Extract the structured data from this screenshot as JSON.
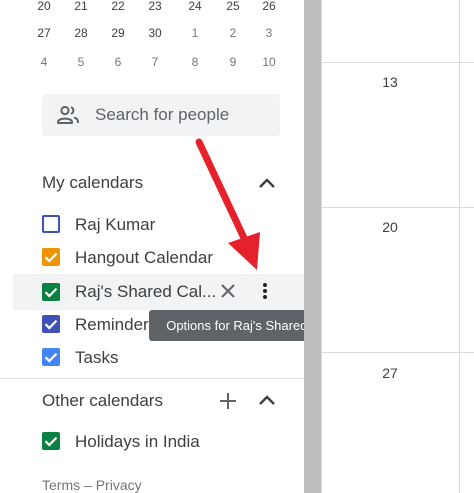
{
  "mini_calendar": {
    "rows": [
      [
        "20",
        "21",
        "22",
        "23",
        "24",
        "25",
        "26"
      ],
      [
        "27",
        "28",
        "29",
        "30",
        "1",
        "2",
        "3"
      ],
      [
        "4",
        "5",
        "6",
        "7",
        "8",
        "9",
        "10"
      ]
    ]
  },
  "search": {
    "placeholder": "Search for people",
    "icon": "people-icon"
  },
  "my_calendars": {
    "title": "My calendars",
    "items": [
      {
        "label": "Raj Kumar",
        "checked": false,
        "color": "#3f51b5"
      },
      {
        "label": "Hangout Calendar",
        "checked": true,
        "color": "#f09300"
      },
      {
        "label": "Raj's Shared Cal...",
        "checked": true,
        "color": "#0b8043"
      },
      {
        "label": "Reminders",
        "checked": true,
        "color": "#3f51b5"
      },
      {
        "label": "Tasks",
        "checked": true,
        "color": "#4285f4"
      }
    ],
    "tooltip": "Options for Raj's Shared Calendar"
  },
  "other_calendars": {
    "title": "Other calendars",
    "items": [
      {
        "label": "Holidays in India",
        "checked": true,
        "color": "#0b8043"
      }
    ]
  },
  "footer": {
    "terms": "Terms",
    "separator": "–",
    "privacy": "Privacy"
  },
  "grid": {
    "dates": [
      "13",
      "20",
      "27"
    ]
  },
  "annotation_color": "#e5212b"
}
